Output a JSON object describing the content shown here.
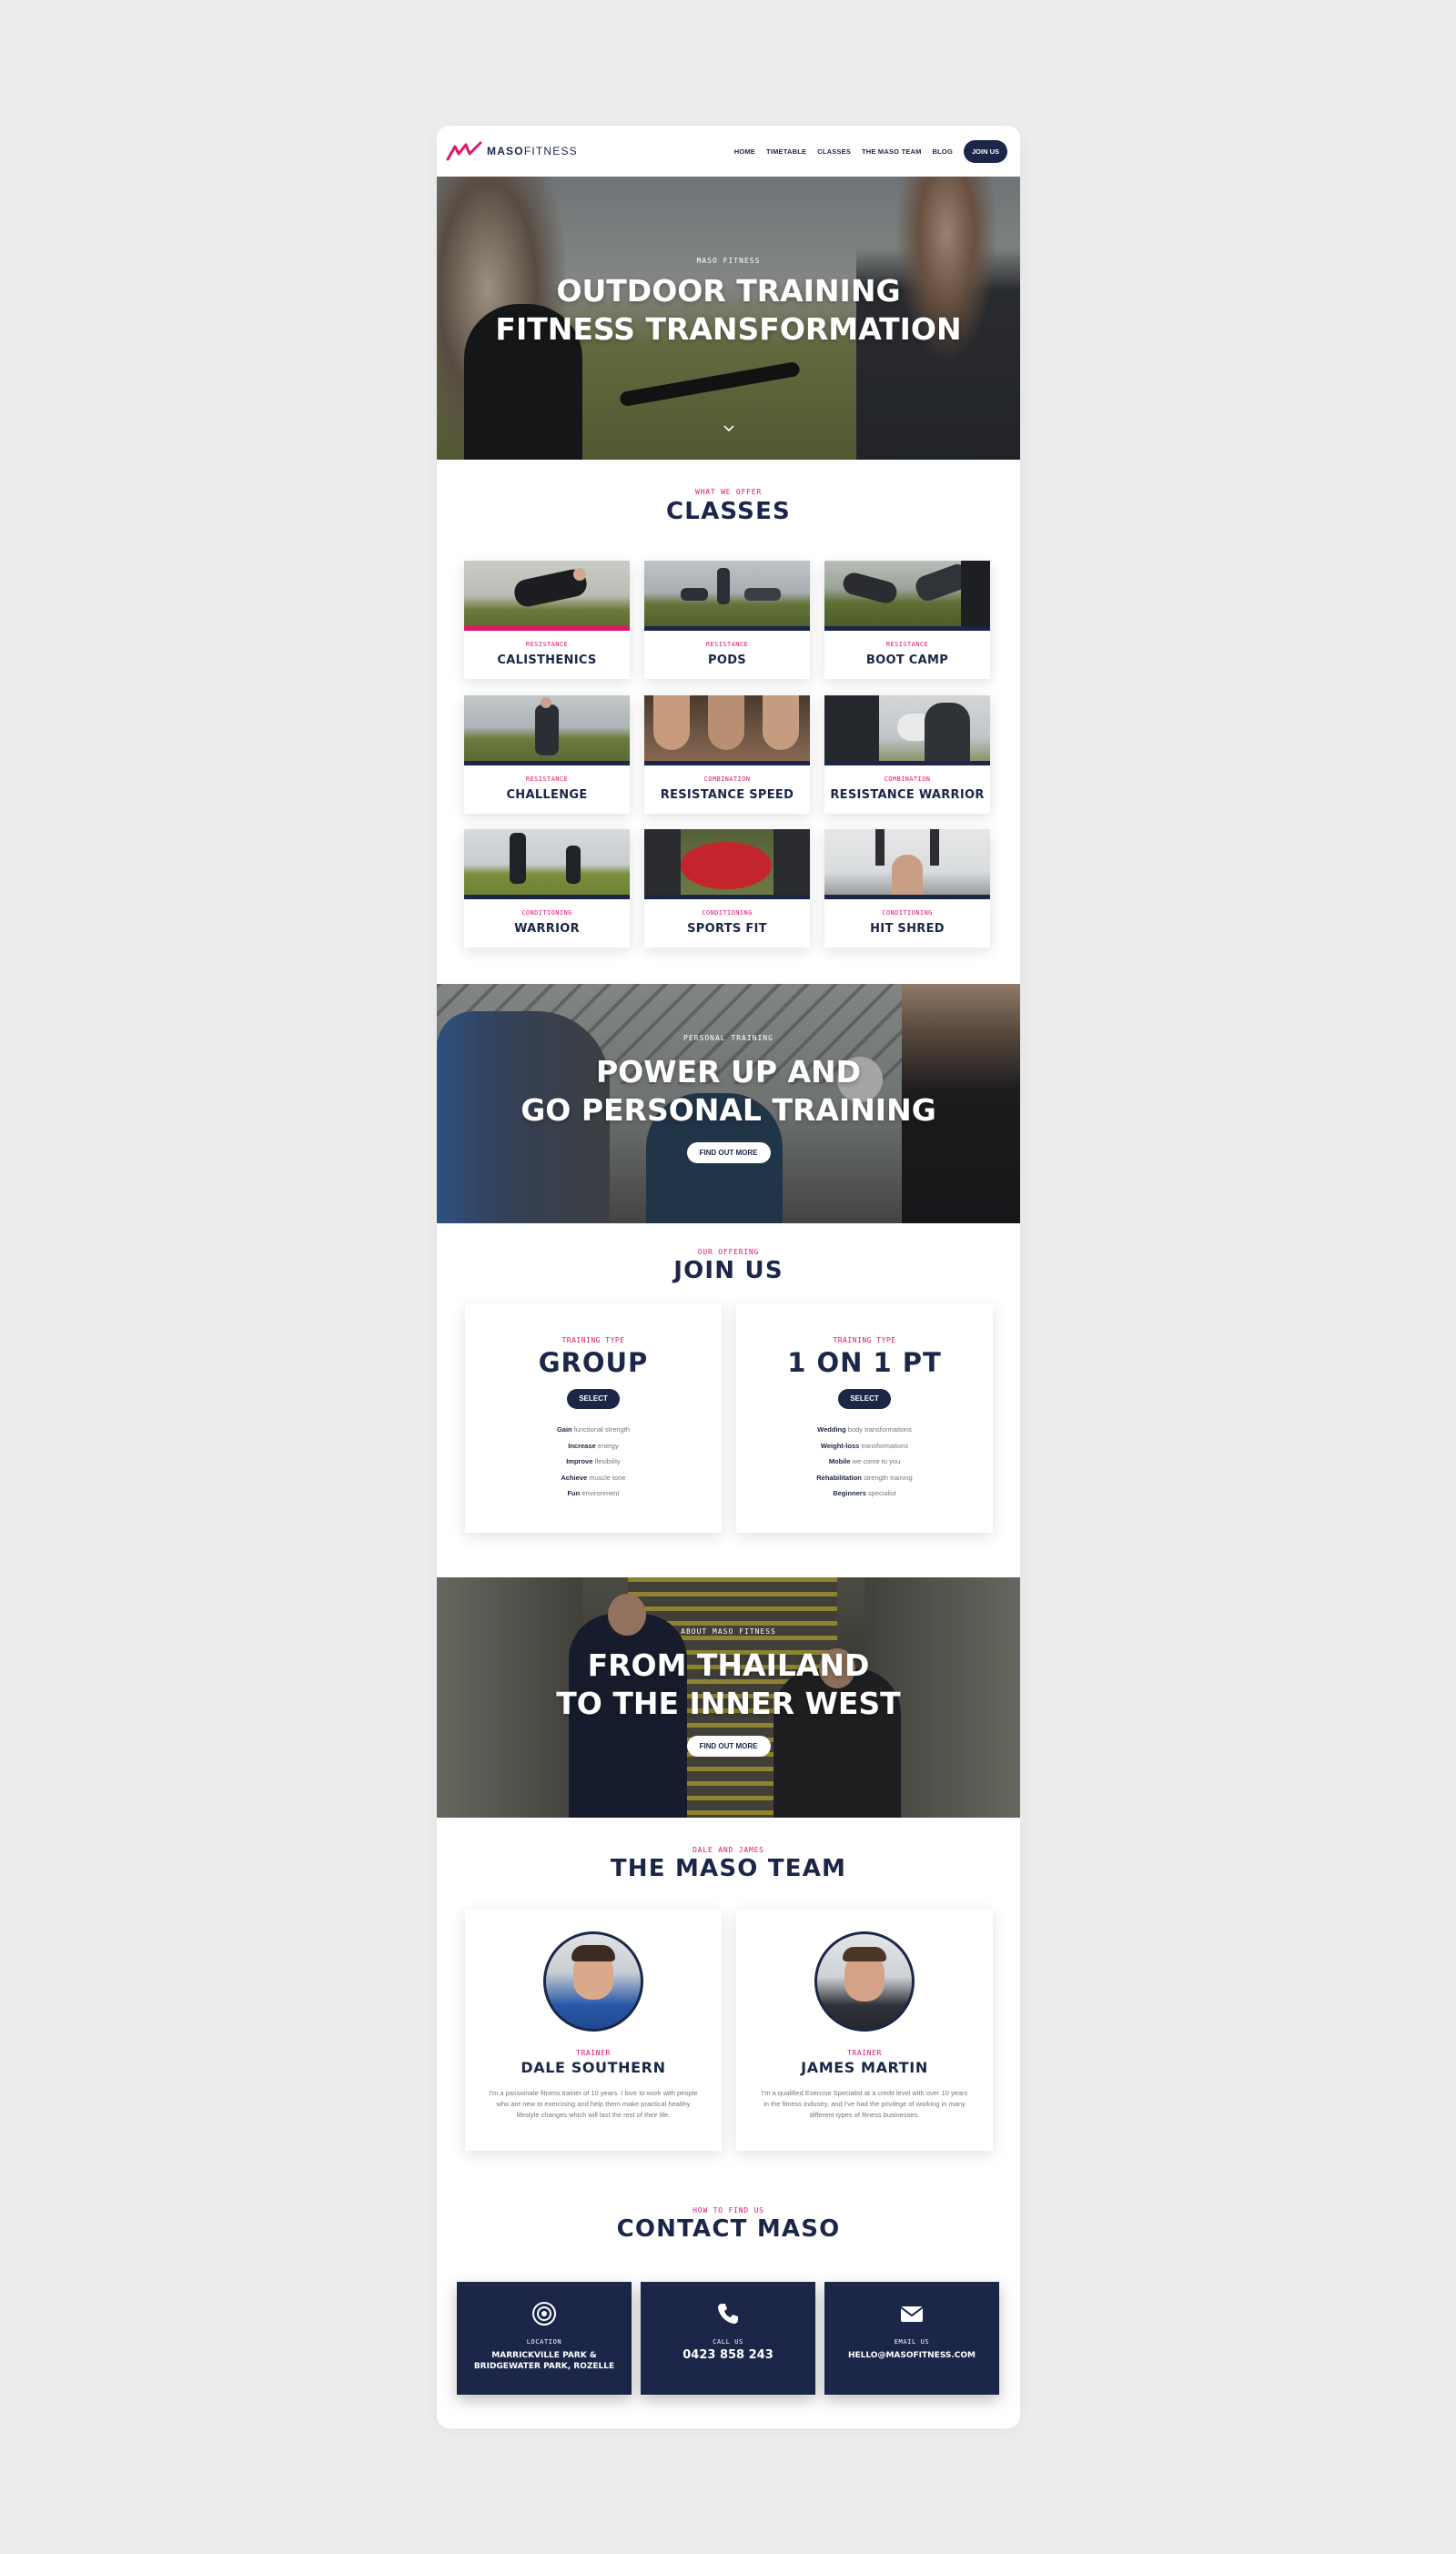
{
  "nav": {
    "logo_bold": "MASO",
    "logo_light": "FITNESS",
    "links": [
      "HOME",
      "TIMETABLE",
      "CLASSES",
      "THE MASO TEAM",
      "BLOG"
    ],
    "join": "JOIN US"
  },
  "hero": {
    "eyebrow": "MASO FITNESS",
    "title_line1": "OUTDOOR TRAINING",
    "title_line2": "FITNESS TRANSFORMATION"
  },
  "classes": {
    "eyebrow": "WHAT WE OFFER",
    "title": "CLASSES",
    "items": [
      {
        "category": "RESISTANCE",
        "name": "CALISTHENICS"
      },
      {
        "category": "RESISTANCE",
        "name": "PODS"
      },
      {
        "category": "RESISTANCE",
        "name": "BOOT CAMP"
      },
      {
        "category": "RESISTANCE",
        "name": "CHALLENGE"
      },
      {
        "category": "COMBINATION",
        "name": "RESISTANCE SPEED"
      },
      {
        "category": "COMBINATION",
        "name": "RESISTANCE WARRIOR"
      },
      {
        "category": "CONDITIONING",
        "name": "WARRIOR"
      },
      {
        "category": "CONDITIONING",
        "name": "SPORTS FIT"
      },
      {
        "category": "CONDITIONING",
        "name": "HIT SHRED"
      }
    ]
  },
  "personal": {
    "eyebrow": "PERSONAL TRAINING",
    "title_line1": "POWER UP AND",
    "title_line2": "GO PERSONAL TRAINING",
    "button": "FIND OUT MORE"
  },
  "join": {
    "eyebrow": "OUR OFFERING",
    "title": "JOIN US",
    "plans": [
      {
        "type": "TRAINING TYPE",
        "name": "GROUP",
        "select": "SELECT",
        "features": [
          {
            "bold": "Gain",
            "rest": " functional strength"
          },
          {
            "bold": "Increase",
            "rest": " energy"
          },
          {
            "bold": "Improve",
            "rest": " flexibility"
          },
          {
            "bold": "Achieve",
            "rest": " muscle tone"
          },
          {
            "bold": "Fun",
            "rest": " environment"
          }
        ]
      },
      {
        "type": "TRAINING TYPE",
        "name": "1 ON 1 PT",
        "select": "SELECT",
        "features": [
          {
            "bold": "Wedding",
            "rest": " body transformations"
          },
          {
            "bold": "Weight-loss",
            "rest": " transformations"
          },
          {
            "bold": "Mobile",
            "rest": " we come to you"
          },
          {
            "bold": "Rehabilitation",
            "rest": " strength training"
          },
          {
            "bold": "Beginners",
            "rest": " specialist"
          }
        ]
      }
    ]
  },
  "about": {
    "eyebrow": "ABOUT MASO FITNESS",
    "title_line1": "FROM THAILAND",
    "title_line2": "TO THE INNER WEST",
    "button": "FIND OUT MORE"
  },
  "team": {
    "eyebrow": "DALE AND JAMES",
    "title": "THE MASO TEAM",
    "members": [
      {
        "role": "TRAINER",
        "name": "DALE SOUTHERN",
        "bio": "I'm a passionate fitness trainer of 10 years. I love to work with people who are new to exercising and help them make practical healthy lifestyle changes which will last the rest of their life."
      },
      {
        "role": "TRAINER",
        "name": "JAMES MARTIN",
        "bio": "I'm a qualified Exercise Specialist at a credit level with over 10 years in the fitness industry, and I've had the privilege of working in many different types of fitness businesses."
      }
    ]
  },
  "contact": {
    "eyebrow": "HOW TO FIND US",
    "title": "CONTACT MASO",
    "items": [
      {
        "icon": "location-target-icon",
        "label": "LOCATION",
        "value": "MARRICKVILLE PARK & BRIDGEWATER PARK, ROZELLE"
      },
      {
        "icon": "phone-icon",
        "label": "CALL US",
        "value": "0423 858 243"
      },
      {
        "icon": "envelope-icon",
        "label": "EMAIL US",
        "value": "HELLO@MASOFITNESS.COM"
      }
    ]
  },
  "colors": {
    "navy": "#1b2648",
    "pink": "#e2156b",
    "background": "#ededed"
  }
}
